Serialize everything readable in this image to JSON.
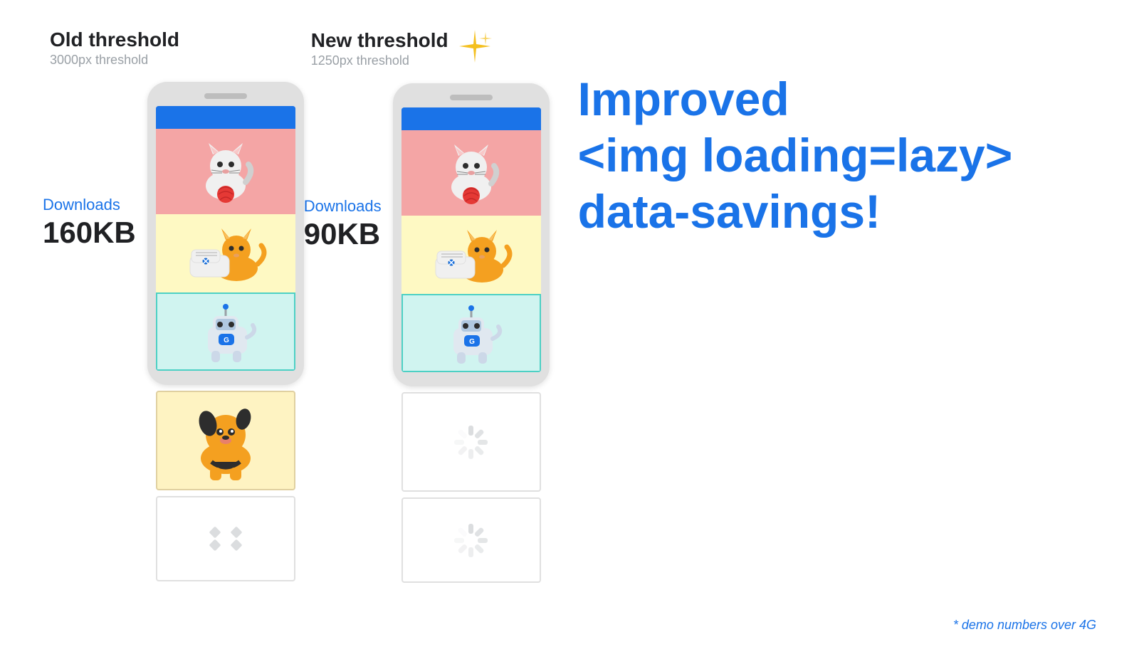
{
  "left_threshold": {
    "title": "Old threshold",
    "subtitle": "3000px threshold"
  },
  "right_threshold": {
    "title": "New threshold",
    "subtitle": "1250px threshold"
  },
  "left_downloads": {
    "label": "Downloads",
    "size": "160KB"
  },
  "right_downloads": {
    "label": "Downloads",
    "size": "90KB"
  },
  "improved_line1": "Improved",
  "improved_line2": "<img loading=lazy>",
  "improved_line3": "data-savings!",
  "demo_note": "* demo numbers over 4G",
  "sparkle": "✦",
  "colors": {
    "blue": "#1a73e8",
    "dark": "#202124",
    "gray": "#9aa0a6"
  }
}
